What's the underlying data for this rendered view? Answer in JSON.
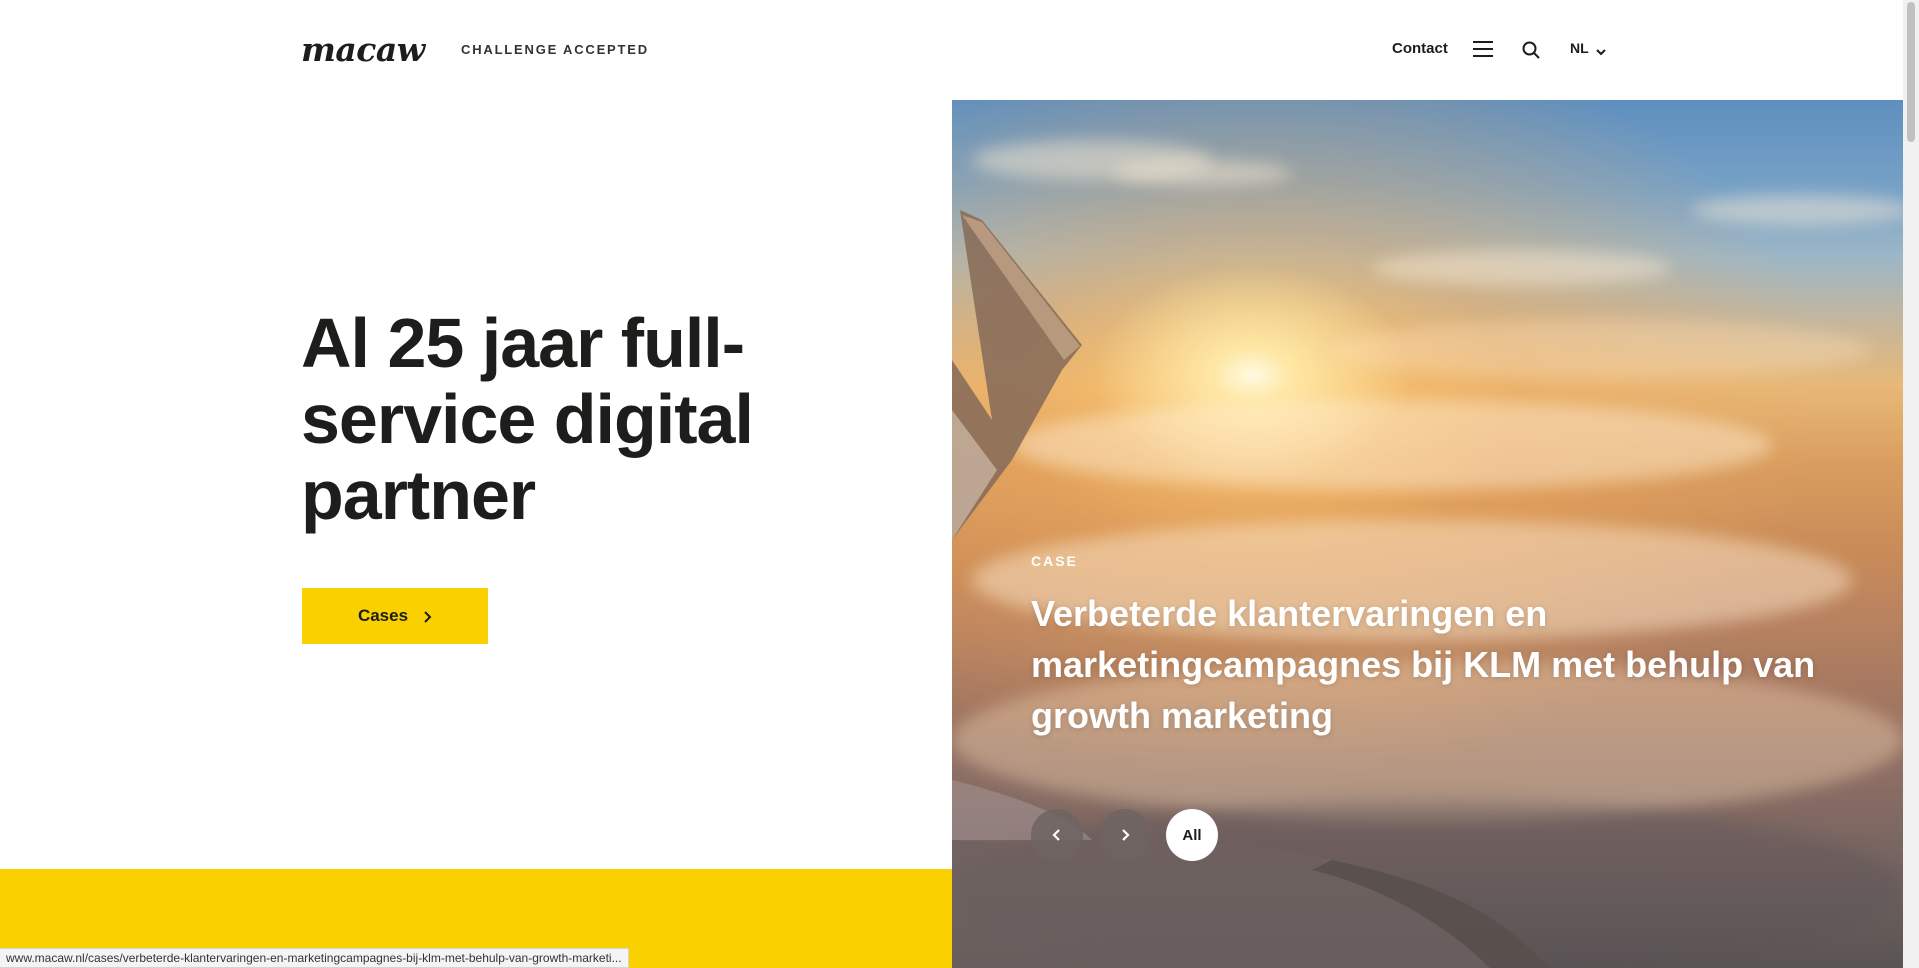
{
  "header": {
    "logo": "macaw",
    "tagline": "CHALLENGE ACCEPTED",
    "contact_label": "Contact",
    "language": "NL",
    "menu_icon": "hamburger-menu-icon",
    "search_icon": "search-icon"
  },
  "hero": {
    "title": "Al 25 jaar full-service digital partner",
    "cases_button": "Cases"
  },
  "featured_case": {
    "label": "CASE",
    "title": "Verbeterde klantervaringen en marketingcampagnes bij KLM met behulp van growth marketing",
    "prev_icon": "chevron-left-icon",
    "next_icon": "chevron-right-icon",
    "all_label": "All"
  },
  "status_bar": {
    "url": "www.macaw.nl/cases/verbeterde-klantervaringen-en-marketingcampagnes-bij-klm-met-behulp-van-growth-marketi..."
  },
  "colors": {
    "accent_yellow": "#fad000",
    "text_dark": "#1d1d1b"
  }
}
